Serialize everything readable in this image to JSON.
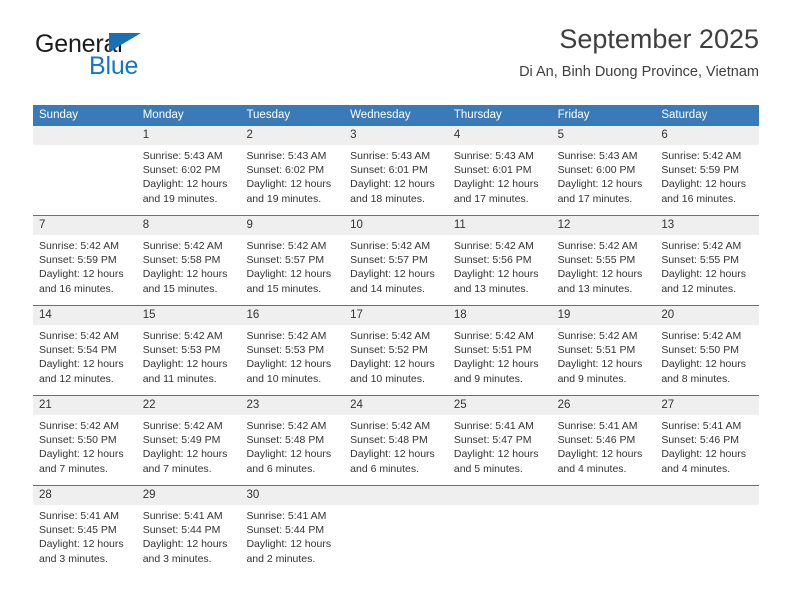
{
  "brand": {
    "name_part1": "General",
    "name_part2": "Blue",
    "triangle_icon": "triangle-icon",
    "triangle_color": "#1a6fb5",
    "text_color": "#1c1c1c",
    "blue_color": "#1277c4"
  },
  "header": {
    "title": "September 2025",
    "subtitle": "Di An, Binh Duong Province, Vietnam"
  },
  "theme": {
    "header_blue": "#3a7ab8",
    "daynum_band": "#efefef",
    "text": "#333333"
  },
  "weekdays": [
    "Sunday",
    "Monday",
    "Tuesday",
    "Wednesday",
    "Thursday",
    "Friday",
    "Saturday"
  ],
  "weeks": [
    {
      "days": [
        {
          "num": "",
          "sunrise": "",
          "sunset": "",
          "daylight1": "",
          "daylight2": ""
        },
        {
          "num": "1",
          "sunrise": "Sunrise: 5:43 AM",
          "sunset": "Sunset: 6:02 PM",
          "daylight1": "Daylight: 12 hours",
          "daylight2": "and 19 minutes."
        },
        {
          "num": "2",
          "sunrise": "Sunrise: 5:43 AM",
          "sunset": "Sunset: 6:02 PM",
          "daylight1": "Daylight: 12 hours",
          "daylight2": "and 19 minutes."
        },
        {
          "num": "3",
          "sunrise": "Sunrise: 5:43 AM",
          "sunset": "Sunset: 6:01 PM",
          "daylight1": "Daylight: 12 hours",
          "daylight2": "and 18 minutes."
        },
        {
          "num": "4",
          "sunrise": "Sunrise: 5:43 AM",
          "sunset": "Sunset: 6:01 PM",
          "daylight1": "Daylight: 12 hours",
          "daylight2": "and 17 minutes."
        },
        {
          "num": "5",
          "sunrise": "Sunrise: 5:43 AM",
          "sunset": "Sunset: 6:00 PM",
          "daylight1": "Daylight: 12 hours",
          "daylight2": "and 17 minutes."
        },
        {
          "num": "6",
          "sunrise": "Sunrise: 5:42 AM",
          "sunset": "Sunset: 5:59 PM",
          "daylight1": "Daylight: 12 hours",
          "daylight2": "and 16 minutes."
        }
      ]
    },
    {
      "days": [
        {
          "num": "7",
          "sunrise": "Sunrise: 5:42 AM",
          "sunset": "Sunset: 5:59 PM",
          "daylight1": "Daylight: 12 hours",
          "daylight2": "and 16 minutes."
        },
        {
          "num": "8",
          "sunrise": "Sunrise: 5:42 AM",
          "sunset": "Sunset: 5:58 PM",
          "daylight1": "Daylight: 12 hours",
          "daylight2": "and 15 minutes."
        },
        {
          "num": "9",
          "sunrise": "Sunrise: 5:42 AM",
          "sunset": "Sunset: 5:57 PM",
          "daylight1": "Daylight: 12 hours",
          "daylight2": "and 15 minutes."
        },
        {
          "num": "10",
          "sunrise": "Sunrise: 5:42 AM",
          "sunset": "Sunset: 5:57 PM",
          "daylight1": "Daylight: 12 hours",
          "daylight2": "and 14 minutes."
        },
        {
          "num": "11",
          "sunrise": "Sunrise: 5:42 AM",
          "sunset": "Sunset: 5:56 PM",
          "daylight1": "Daylight: 12 hours",
          "daylight2": "and 13 minutes."
        },
        {
          "num": "12",
          "sunrise": "Sunrise: 5:42 AM",
          "sunset": "Sunset: 5:55 PM",
          "daylight1": "Daylight: 12 hours",
          "daylight2": "and 13 minutes."
        },
        {
          "num": "13",
          "sunrise": "Sunrise: 5:42 AM",
          "sunset": "Sunset: 5:55 PM",
          "daylight1": "Daylight: 12 hours",
          "daylight2": "and 12 minutes."
        }
      ]
    },
    {
      "days": [
        {
          "num": "14",
          "sunrise": "Sunrise: 5:42 AM",
          "sunset": "Sunset: 5:54 PM",
          "daylight1": "Daylight: 12 hours",
          "daylight2": "and 12 minutes."
        },
        {
          "num": "15",
          "sunrise": "Sunrise: 5:42 AM",
          "sunset": "Sunset: 5:53 PM",
          "daylight1": "Daylight: 12 hours",
          "daylight2": "and 11 minutes."
        },
        {
          "num": "16",
          "sunrise": "Sunrise: 5:42 AM",
          "sunset": "Sunset: 5:53 PM",
          "daylight1": "Daylight: 12 hours",
          "daylight2": "and 10 minutes."
        },
        {
          "num": "17",
          "sunrise": "Sunrise: 5:42 AM",
          "sunset": "Sunset: 5:52 PM",
          "daylight1": "Daylight: 12 hours",
          "daylight2": "and 10 minutes."
        },
        {
          "num": "18",
          "sunrise": "Sunrise: 5:42 AM",
          "sunset": "Sunset: 5:51 PM",
          "daylight1": "Daylight: 12 hours",
          "daylight2": "and 9 minutes."
        },
        {
          "num": "19",
          "sunrise": "Sunrise: 5:42 AM",
          "sunset": "Sunset: 5:51 PM",
          "daylight1": "Daylight: 12 hours",
          "daylight2": "and 9 minutes."
        },
        {
          "num": "20",
          "sunrise": "Sunrise: 5:42 AM",
          "sunset": "Sunset: 5:50 PM",
          "daylight1": "Daylight: 12 hours",
          "daylight2": "and 8 minutes."
        }
      ]
    },
    {
      "days": [
        {
          "num": "21",
          "sunrise": "Sunrise: 5:42 AM",
          "sunset": "Sunset: 5:50 PM",
          "daylight1": "Daylight: 12 hours",
          "daylight2": "and 7 minutes."
        },
        {
          "num": "22",
          "sunrise": "Sunrise: 5:42 AM",
          "sunset": "Sunset: 5:49 PM",
          "daylight1": "Daylight: 12 hours",
          "daylight2": "and 7 minutes."
        },
        {
          "num": "23",
          "sunrise": "Sunrise: 5:42 AM",
          "sunset": "Sunset: 5:48 PM",
          "daylight1": "Daylight: 12 hours",
          "daylight2": "and 6 minutes."
        },
        {
          "num": "24",
          "sunrise": "Sunrise: 5:42 AM",
          "sunset": "Sunset: 5:48 PM",
          "daylight1": "Daylight: 12 hours",
          "daylight2": "and 6 minutes."
        },
        {
          "num": "25",
          "sunrise": "Sunrise: 5:41 AM",
          "sunset": "Sunset: 5:47 PM",
          "daylight1": "Daylight: 12 hours",
          "daylight2": "and 5 minutes."
        },
        {
          "num": "26",
          "sunrise": "Sunrise: 5:41 AM",
          "sunset": "Sunset: 5:46 PM",
          "daylight1": "Daylight: 12 hours",
          "daylight2": "and 4 minutes."
        },
        {
          "num": "27",
          "sunrise": "Sunrise: 5:41 AM",
          "sunset": "Sunset: 5:46 PM",
          "daylight1": "Daylight: 12 hours",
          "daylight2": "and 4 minutes."
        }
      ]
    },
    {
      "days": [
        {
          "num": "28",
          "sunrise": "Sunrise: 5:41 AM",
          "sunset": "Sunset: 5:45 PM",
          "daylight1": "Daylight: 12 hours",
          "daylight2": "and 3 minutes."
        },
        {
          "num": "29",
          "sunrise": "Sunrise: 5:41 AM",
          "sunset": "Sunset: 5:44 PM",
          "daylight1": "Daylight: 12 hours",
          "daylight2": "and 3 minutes."
        },
        {
          "num": "30",
          "sunrise": "Sunrise: 5:41 AM",
          "sunset": "Sunset: 5:44 PM",
          "daylight1": "Daylight: 12 hours",
          "daylight2": "and 2 minutes."
        },
        {
          "num": "",
          "sunrise": "",
          "sunset": "",
          "daylight1": "",
          "daylight2": ""
        },
        {
          "num": "",
          "sunrise": "",
          "sunset": "",
          "daylight1": "",
          "daylight2": ""
        },
        {
          "num": "",
          "sunrise": "",
          "sunset": "",
          "daylight1": "",
          "daylight2": ""
        },
        {
          "num": "",
          "sunrise": "",
          "sunset": "",
          "daylight1": "",
          "daylight2": ""
        }
      ]
    }
  ]
}
